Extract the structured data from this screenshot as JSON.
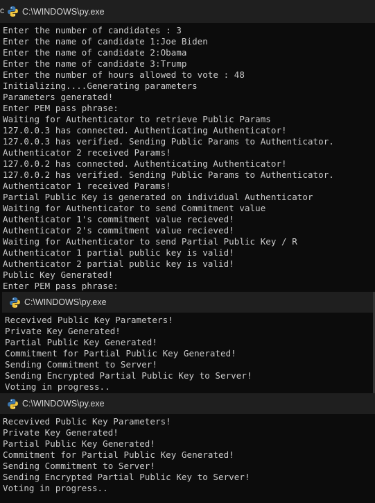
{
  "windows": [
    {
      "title": "C:\\WINDOWS\\py.exe",
      "left_glyph": "c",
      "lines": [
        "Enter the number of candidates : 3",
        "Enter the name of candidate 1:Joe Biden",
        "Enter the name of candidate 2:Obama",
        "Enter the name of candidate 3:Trump",
        "Enter the number of hours allowed to vote : 48",
        "Initializing....Generating parameters",
        "Parameters generated!",
        "Enter PEM pass phrase:",
        "Waiting for Authenticator to retrieve Public Params",
        "127.0.0.3 has connected. Authenticating Authenticator!",
        "127.0.0.3 has verified. Sending Public Params to Authenticator.",
        "Authenticator 2 received Params!",
        "127.0.0.2 has connected. Authenticating Authenticator!",
        "127.0.0.2 has verified. Sending Public Params to Authenticator.",
        "Authenticator 1 received Params!",
        "Partial Public Key is generated on individual Authenticator",
        "Waiting for Authenticator to send Commitment value",
        "Authenticator 1's commitment value recieved!",
        "Authenticator 2's commitment value recieved!",
        "Waiting for Authenticator to send Partial Public Key / R",
        "Authenticator 1 partial public key is valid!",
        "Authenticator 2 partial public key is valid!",
        "Public Key Generated!",
        "Enter PEM pass phrase:"
      ]
    },
    {
      "title": "C:\\WINDOWS\\py.exe",
      "lines": [
        "Recevived Public Key Parameters!",
        "Private Key Generated!",
        "Partial Public Key Generated!",
        "Commitment for Partial Public Key Generated!",
        "Sending Commitment to Server!",
        "Sending Encrypted Partial Public Key to Server!",
        "Voting in progress.."
      ]
    },
    {
      "title": "C:\\WINDOWS\\py.exe",
      "lines": [
        "Recevived Public Key Parameters!",
        "Private Key Generated!",
        "Partial Public Key Generated!",
        "Commitment for Partial Public Key Generated!",
        "Sending Commitment to Server!",
        "Sending Encrypted Partial Public Key to Server!",
        "Voting in progress.."
      ]
    }
  ],
  "icons": {
    "window_icon": "python-icon"
  },
  "colors": {
    "console_bg": "#0c0c0c",
    "titlebar_bg": "#1f1f1f",
    "text": "#cccccc"
  }
}
